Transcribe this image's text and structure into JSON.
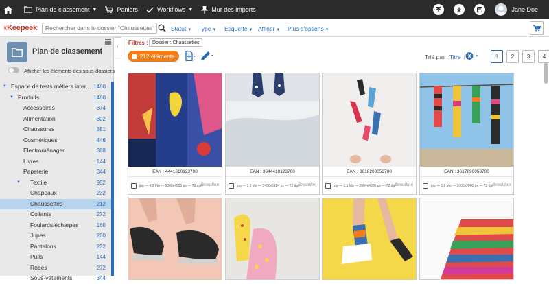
{
  "topbar": {
    "title": "Plan de classement",
    "baskets": "Paniers",
    "workflows": "Workflows",
    "imports": "Mur des imports",
    "user": "Jane Doe"
  },
  "search": {
    "logo": "Keepeek",
    "placeholder": "Rechercher dans le dossier \"Chaussettes\"",
    "filters": [
      "Statut",
      "Type",
      "Etiquette",
      "Affiner",
      "Plus d'options"
    ]
  },
  "sidebar": {
    "title": "Plan de classement",
    "toggle_label": "Afficher les éléments des sous-dossiers",
    "tree": [
      {
        "label": "Espace de tests métiers inter...",
        "count": "1460",
        "level": 0,
        "arrow": "▼"
      },
      {
        "label": "Produits",
        "count": "1460",
        "level": 1,
        "arrow": "▼"
      },
      {
        "label": "Accessoires",
        "count": "374",
        "level": 2,
        "arrow": ""
      },
      {
        "label": "Alimentation",
        "count": "302",
        "level": 2,
        "arrow": ""
      },
      {
        "label": "Chaussures",
        "count": "881",
        "level": 2,
        "arrow": ""
      },
      {
        "label": "Cosmétiques",
        "count": "446",
        "level": 2,
        "arrow": ""
      },
      {
        "label": "Electroménager",
        "count": "388",
        "level": 2,
        "arrow": ""
      },
      {
        "label": "Livres",
        "count": "144",
        "level": 2,
        "arrow": ""
      },
      {
        "label": "Papeterie",
        "count": "344",
        "level": 2,
        "arrow": ""
      },
      {
        "label": "Textile",
        "count": "952",
        "level": 2,
        "arrow": "▼"
      },
      {
        "label": "Chapeaux",
        "count": "232",
        "level": 3,
        "arrow": ""
      },
      {
        "label": "Chaussettes",
        "count": "212",
        "level": 3,
        "arrow": "",
        "selected": true
      },
      {
        "label": "Collants",
        "count": "272",
        "level": 3,
        "arrow": ""
      },
      {
        "label": "Foulards/écharpes",
        "count": "160",
        "level": 3,
        "arrow": ""
      },
      {
        "label": "Jupes",
        "count": "200",
        "level": 3,
        "arrow": ""
      },
      {
        "label": "Pantalons",
        "count": "232",
        "level": 3,
        "arrow": ""
      },
      {
        "label": "Pulls",
        "count": "144",
        "level": 3,
        "arrow": ""
      },
      {
        "label": "Robes",
        "count": "272",
        "level": 3,
        "arrow": ""
      },
      {
        "label": "Sous-vêtements",
        "count": "344",
        "level": 3,
        "arrow": ""
      }
    ]
  },
  "main": {
    "filters_label": "Filtres :",
    "filter_chip": "Dossier : Chaussettes",
    "count_label": "212 éléments",
    "sort_label": "Trié par :",
    "sort_value": "Titre ↓",
    "pages": [
      "1",
      "2",
      "3",
      "4"
    ],
    "cards": [
      {
        "ean": "EAN : 4441610123700",
        "meta": "jpg — 4,3 Mo — 6000x4000 px — 72 dpi",
        "status": "Brouillon"
      },
      {
        "ean": "EAN : 3644410123700",
        "meta": "jpg — 1,9 Mo — 3456x5184 px — 72 dpi",
        "status": "Brouillon"
      },
      {
        "ean": "EAN : 3618200058700",
        "meta": "jpg — 1,1 Mo — 2664x4000 px — 72 dpi",
        "status": "Brouillon"
      },
      {
        "ean": "EAN : 3617890058700",
        "meta": "jpg — 1,8 Mo — 3000x2000 px — 72 dpi",
        "status": "Brouillon"
      }
    ]
  },
  "colors": {
    "topbar": "#2b2b2b",
    "accent": "#2a6ebb",
    "badge": "#f07d1a",
    "selected": "#b7d4ee"
  }
}
